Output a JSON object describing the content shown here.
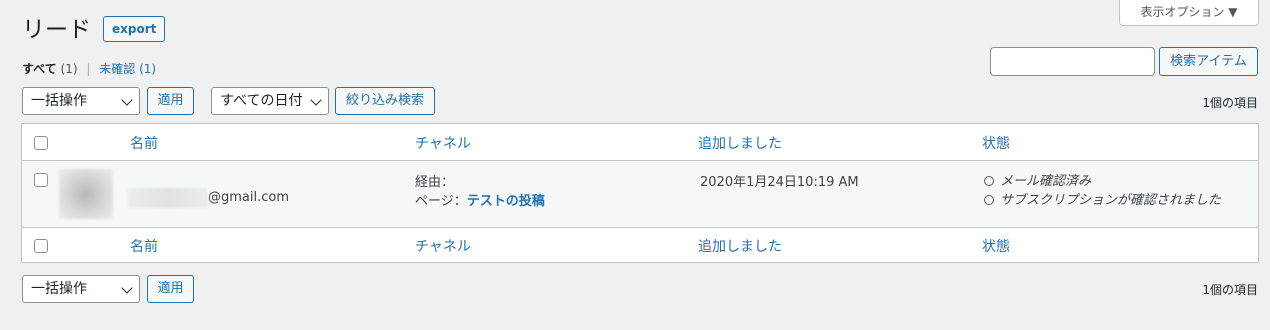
{
  "page": {
    "title": "リード",
    "export_label": "export",
    "screen_options_label": "表示オプション ▼"
  },
  "views": {
    "all_label": "すべて",
    "all_count": "(1)",
    "separator": "|",
    "unconfirmed_label": "未確認",
    "unconfirmed_count": "(1)"
  },
  "search": {
    "value": "",
    "button_label": "検索アイテム"
  },
  "top_filters": {
    "bulk_action": "一括操作",
    "apply_label": "適用",
    "date_filter": "すべての日付",
    "filter_button_label": "絞り込み検索",
    "item_count": "1個の項目"
  },
  "table": {
    "columns": [
      "名前",
      "チャネル",
      "追加しました",
      "状態"
    ],
    "rows": [
      {
        "email": "@gmail.com",
        "channel_via": "経由：",
        "channel_page_label": "ページ：",
        "channel_page_link": "テストの投稿",
        "added": "2020年1月24日10:19 AM",
        "status": [
          "メール確認済み",
          "サブスクリプションが確認されました"
        ]
      }
    ]
  },
  "bottom_filters": {
    "bulk_action": "一括操作",
    "apply_label": "適用",
    "item_count": "1個の項目"
  }
}
